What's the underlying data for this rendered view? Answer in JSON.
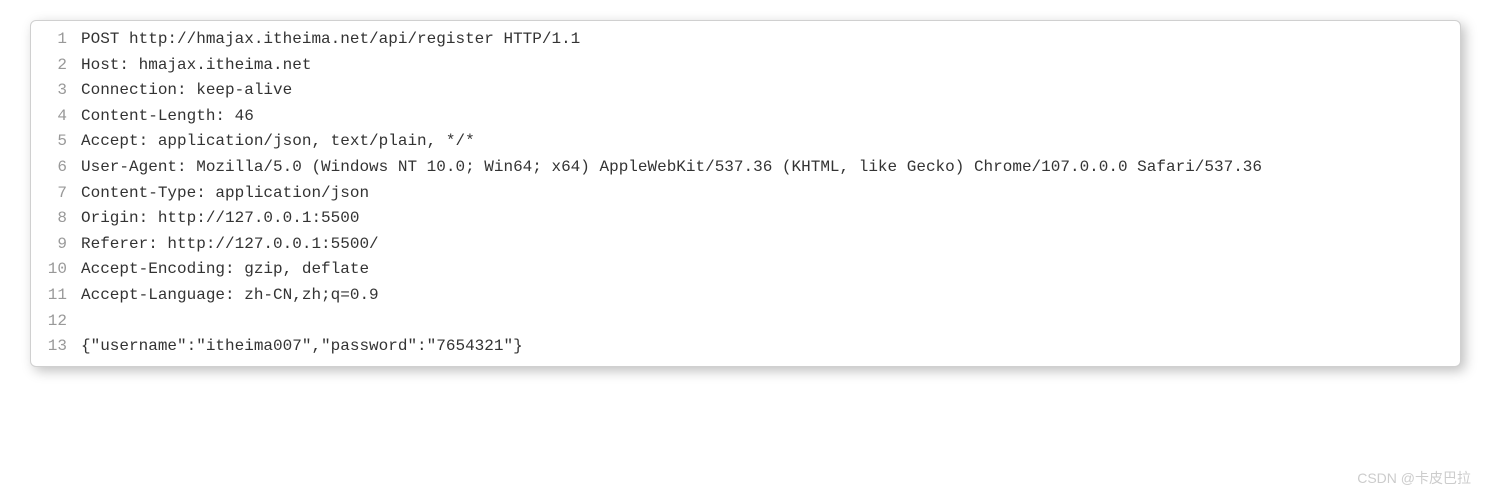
{
  "lines": [
    {
      "num": "1",
      "text": "POST http://hmajax.itheima.net/api/register HTTP/1.1"
    },
    {
      "num": "2",
      "text": "Host: hmajax.itheima.net"
    },
    {
      "num": "3",
      "text": "Connection: keep-alive"
    },
    {
      "num": "4",
      "text": "Content-Length: 46"
    },
    {
      "num": "5",
      "text": "Accept: application/json, text/plain, */*"
    },
    {
      "num": "6",
      "text": "User-Agent: Mozilla/5.0 (Windows NT 10.0; Win64; x64) AppleWebKit/537.36 (KHTML, like Gecko) Chrome/107.0.0.0 Safari/537.36"
    },
    {
      "num": "7",
      "text": "Content-Type: application/json"
    },
    {
      "num": "8",
      "text": "Origin: http://127.0.0.1:5500"
    },
    {
      "num": "9",
      "text": "Referer: http://127.0.0.1:5500/"
    },
    {
      "num": "10",
      "text": "Accept-Encoding: gzip, deflate"
    },
    {
      "num": "11",
      "text": "Accept-Language: zh-CN,zh;q=0.9"
    },
    {
      "num": "12",
      "text": ""
    },
    {
      "num": "13",
      "text": "{\"username\":\"itheima007\",\"password\":\"7654321\"}"
    }
  ],
  "watermark": "CSDN @卡皮巴拉"
}
